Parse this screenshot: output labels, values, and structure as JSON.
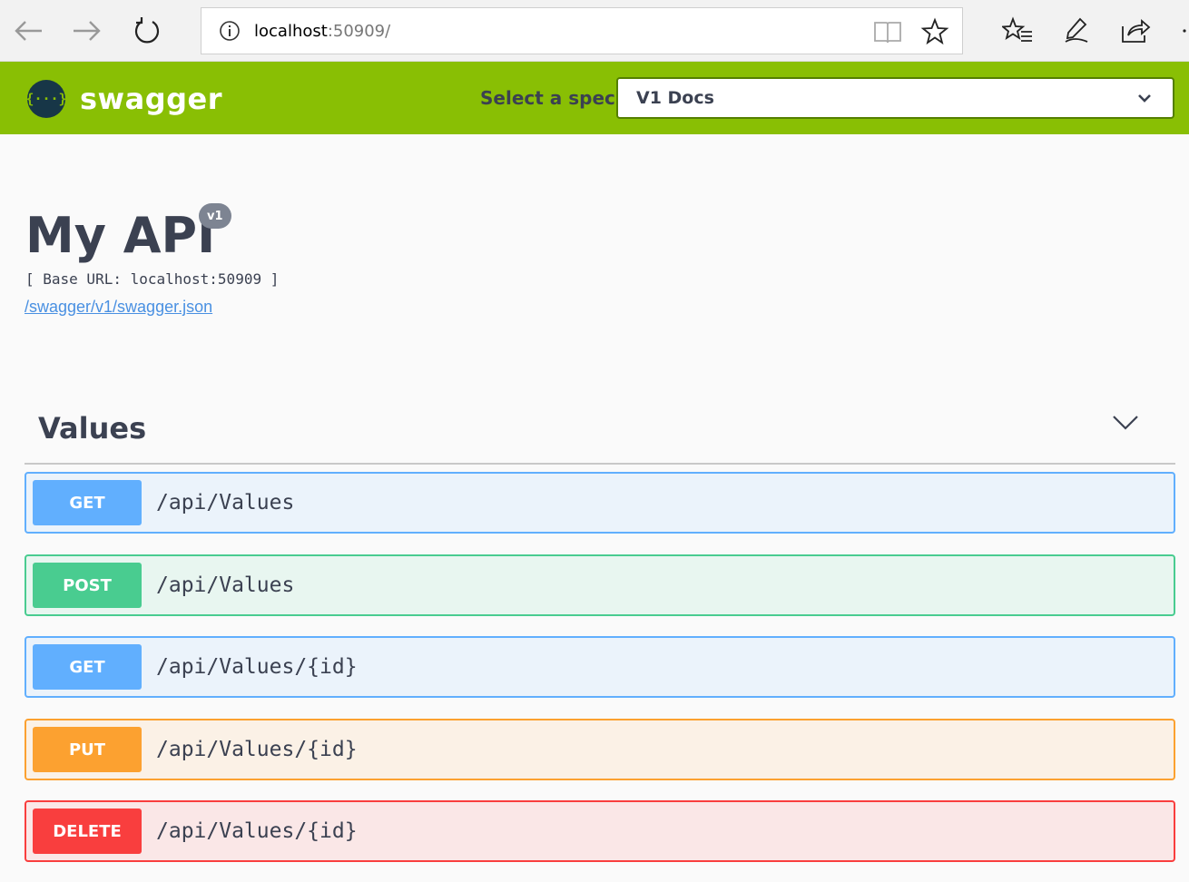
{
  "browser": {
    "url_host": "localhost",
    "url_rest": ":50909/"
  },
  "topbar": {
    "brand": "swagger",
    "logo_glyph": "{···}",
    "select_label": "Select a spec",
    "selected_spec": "V1 Docs"
  },
  "info": {
    "title": "My API",
    "version": "v1",
    "base_url": "[ Base URL: localhost:50909 ]",
    "spec_link": "/swagger/v1/swagger.json"
  },
  "tag": {
    "name": "Values"
  },
  "operations": [
    {
      "method": "GET",
      "path": "/api/Values"
    },
    {
      "method": "POST",
      "path": "/api/Values"
    },
    {
      "method": "GET",
      "path": "/api/Values/{id}"
    },
    {
      "method": "PUT",
      "path": "/api/Values/{id}"
    },
    {
      "method": "DELETE",
      "path": "/api/Values/{id}"
    }
  ],
  "colors": {
    "topbar": "#89bf04",
    "get": "#61affe",
    "post": "#49cc90",
    "put": "#fca130",
    "delete": "#f93e3e"
  },
  "icons": [
    "back-arrow-icon",
    "forward-arrow-icon",
    "refresh-icon",
    "info-icon",
    "reading-view-icon",
    "favorite-star-icon",
    "favorites-list-icon",
    "pen-icon",
    "share-icon",
    "chevron-down-icon"
  ]
}
